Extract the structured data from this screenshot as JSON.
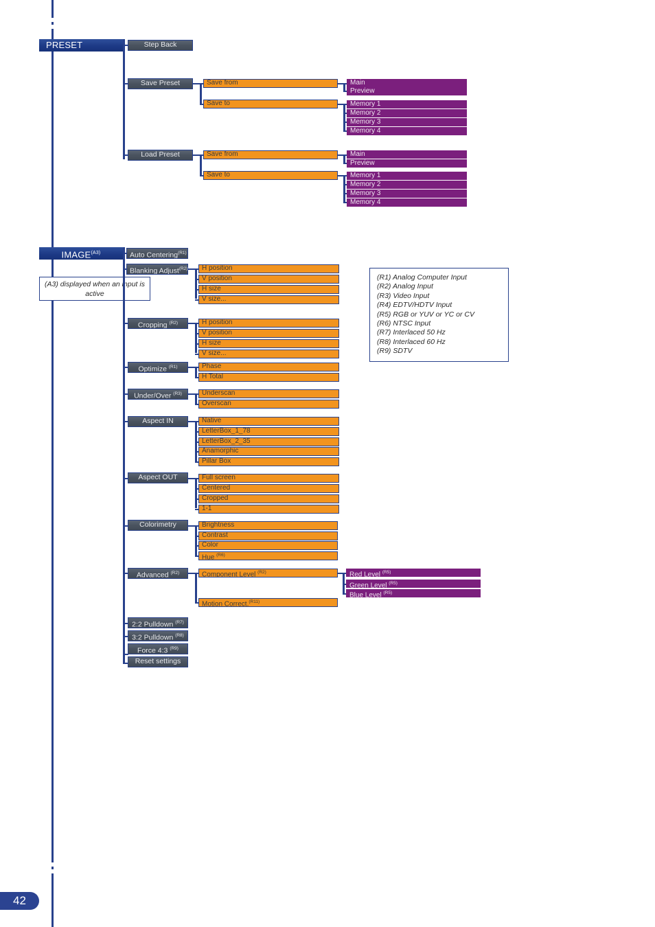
{
  "page": {
    "number": "42"
  },
  "preset": {
    "title": "PRESET",
    "step_back": "Step Back",
    "save_preset": {
      "label": "Save Preset",
      "save_from": {
        "label": "Save from",
        "options": [
          "Main",
          "Preview"
        ]
      },
      "save_to": {
        "label": "Save to",
        "options": [
          "Memory 1",
          "Memory 2",
          "Memory 3",
          "Memory 4"
        ]
      }
    },
    "load_preset": {
      "label": "Load Preset",
      "save_from": {
        "label": "Save from",
        "options": [
          "Main",
          "Preview"
        ]
      },
      "save_to": {
        "label": "Save to",
        "options": [
          "Memory 1",
          "Memory 2",
          "Memory 3",
          "Memory 4"
        ]
      }
    }
  },
  "image": {
    "title": "IMAGE",
    "title_sup": "(A3)",
    "note": "(A3) displayed when an input is active",
    "auto_centering": {
      "label": "Auto Centering",
      "sup": "(R1)"
    },
    "blanking_adjust": {
      "label": "Blanking Adjust",
      "sup": "(R2)",
      "options": [
        "H position",
        "V position",
        "H size",
        "V size..."
      ]
    },
    "cropping": {
      "label": "Cropping",
      "sup": "(R2)",
      "options": [
        "H position",
        "V position",
        "H size",
        "V size..."
      ]
    },
    "optimize": {
      "label": "Optimize",
      "sup": "(R1)",
      "options": [
        "Phase",
        "H Total"
      ]
    },
    "under_over": {
      "label": "Under/Over",
      "sup": "(R3)",
      "options": [
        "Underscan",
        "Overscan"
      ]
    },
    "aspect_in": {
      "label": "Aspect IN",
      "sup": "",
      "options": [
        "Native",
        "LetterBox_1_78",
        "LetterBox_2_35",
        "Anamorphic",
        "Pillar Box"
      ]
    },
    "aspect_out": {
      "label": "Aspect OUT",
      "sup": "",
      "options": [
        "Full screen",
        "Centered",
        "Cropped",
        "1-1"
      ]
    },
    "colorimetry": {
      "label": "Colorimetry",
      "sup": "",
      "options": [
        {
          "label": "Brightness",
          "sup": ""
        },
        {
          "label": "Contrast",
          "sup": ""
        },
        {
          "label": "Color",
          "sup": ""
        },
        {
          "label": "Hue ",
          "sup": "(R6)"
        }
      ]
    },
    "advanced": {
      "label": "Advanced",
      "sup": "(R2)",
      "component_level": {
        "label": "Component Level ",
        "sup": "(R2)",
        "levels": [
          {
            "label": "Red Level ",
            "sup": "(R5)"
          },
          {
            "label": "Green Level ",
            "sup": "(R5)"
          },
          {
            "label": "Blue Level ",
            "sup": "(R5)"
          }
        ]
      },
      "motion_correct": {
        "label": "Motion Correct.",
        "sup": "(R11)"
      }
    },
    "pulldown_22": {
      "label": "2:2 Pulldown ",
      "sup": "(R7)"
    },
    "pulldown_32": {
      "label": "3:2 Pulldown ",
      "sup": "(R8)"
    },
    "force_43": {
      "label": "Force 4:3 ",
      "sup": "(R9)"
    },
    "reset_settings": {
      "label": "Reset settings",
      "sup": ""
    }
  },
  "legend": {
    "entries": [
      "(R1) Analog Computer Input",
      "(R2) Analog Input",
      "(R3) Video Input",
      "(R4) EDTV/HDTV Input",
      "(R5) RGB or YUV or YC or CV",
      "(R6) NTSC Input",
      "(R7) Interlaced 50 Hz",
      "(R8) Interlaced 60 Hz",
      "(R9) SDTV"
    ]
  },
  "colors": {
    "blue": "#28418c",
    "section_blue": "#1d3a86",
    "slate": "#4a535f",
    "orange": "#f2941f",
    "purple": "#7b1f7d",
    "badge": "#2b4391"
  }
}
